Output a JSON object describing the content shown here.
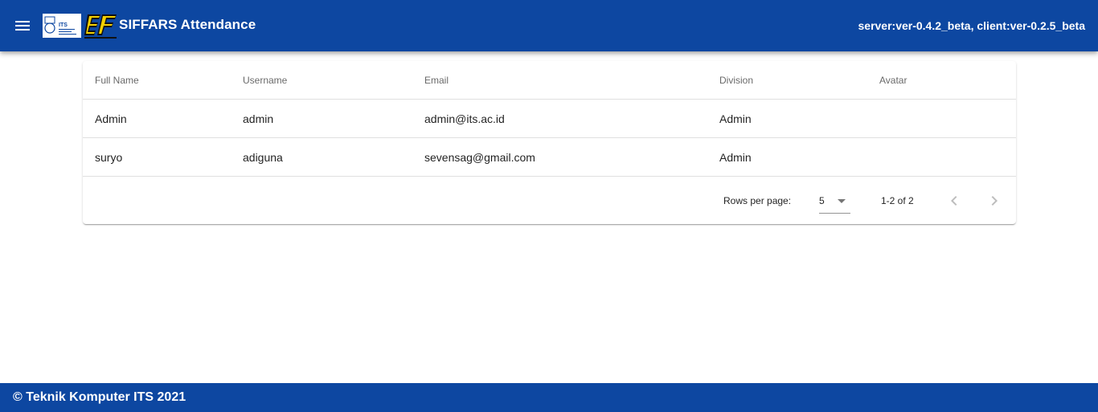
{
  "header": {
    "title": "SIFFARS Attendance",
    "version": "server:ver-0.4.2_beta, client:ver-0.2.5_beta",
    "its_logo_text": "ITS",
    "brand_color": "#0d47a1"
  },
  "table": {
    "columns": [
      "Full Name",
      "Username",
      "Email",
      "Division",
      "Avatar"
    ],
    "rows": [
      {
        "full_name": "Admin",
        "username": "admin",
        "email": "admin@its.ac.id",
        "division": "Admin",
        "avatar": ""
      },
      {
        "full_name": "suryo",
        "username": "adiguna",
        "email": "sevensag@gmail.com",
        "division": "Admin",
        "avatar": ""
      }
    ]
  },
  "pagination": {
    "rows_per_page_label": "Rows per page:",
    "rows_per_page_value": "5",
    "range_text": "1-2 of 2"
  },
  "footer": {
    "copyright": "© Teknik Komputer ITS 2021"
  },
  "icons": {
    "menu": "menu-icon",
    "prev": "chevron-left-icon",
    "next": "chevron-right-icon",
    "dropdown": "arrow-drop-down-icon"
  }
}
